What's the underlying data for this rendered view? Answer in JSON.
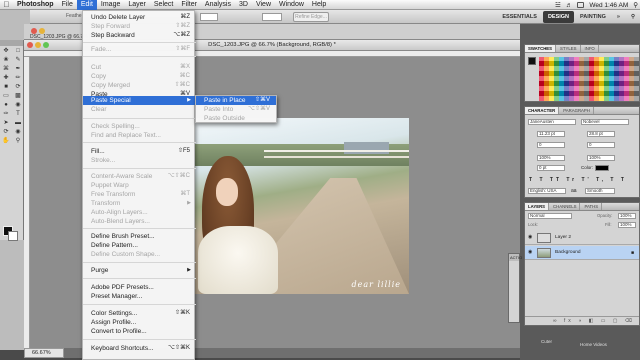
{
  "menubar": {
    "apple": "",
    "items": [
      "Photoshop",
      "File",
      "Edit",
      "Image",
      "Layer",
      "Select",
      "Filter",
      "Analysis",
      "3D",
      "View",
      "Window",
      "Help"
    ],
    "clock": "Wed 1:46 AM"
  },
  "options_bar": {
    "refine_label": "Refine Edge...",
    "feather_label": "Feathe",
    "workspaces": [
      "ESSENTIALS",
      "DESIGN",
      "PAINTING"
    ],
    "selected_workspace": "DESIGN",
    "cs_live": "CS Live"
  },
  "document": {
    "title": "DSC_1203.JPG @ 66.7% (Background, RGB/8) *",
    "behind_title": "DSC_1203.JPG @ 66.7% (Background, RGB/8) *",
    "zoom": "66.67%",
    "watermark": "dear lillie"
  },
  "edit_menu": {
    "items": [
      {
        "label": "Undo Delete Layer",
        "shortcut": "⌘Z",
        "disabled": false,
        "submenu": false
      },
      {
        "label": "Step Forward",
        "shortcut": "⇧⌘Z",
        "disabled": true,
        "submenu": false
      },
      {
        "label": "Step Backward",
        "shortcut": "⌥⌘Z",
        "disabled": false,
        "submenu": false
      },
      {
        "label": "Fade...",
        "shortcut": "⇧⌘F",
        "disabled": true,
        "submenu": false
      },
      {
        "label": "Cut",
        "shortcut": "⌘X",
        "disabled": true,
        "submenu": false
      },
      {
        "label": "Copy",
        "shortcut": "⌘C",
        "disabled": true,
        "submenu": false
      },
      {
        "label": "Copy Merged",
        "shortcut": "⇧⌘C",
        "disabled": true,
        "submenu": false
      },
      {
        "label": "Paste",
        "shortcut": "⌘V",
        "disabled": false,
        "submenu": false
      },
      {
        "label": "Paste Special",
        "shortcut": "",
        "disabled": false,
        "submenu": true,
        "selected": true
      },
      {
        "label": "Clear",
        "shortcut": "",
        "disabled": true,
        "submenu": false
      },
      {
        "label": "Check Spelling...",
        "shortcut": "",
        "disabled": true,
        "submenu": false
      },
      {
        "label": "Find and Replace Text...",
        "shortcut": "",
        "disabled": true,
        "submenu": false
      },
      {
        "label": "Fill...",
        "shortcut": "⇧F5",
        "disabled": false,
        "submenu": false
      },
      {
        "label": "Stroke...",
        "shortcut": "",
        "disabled": true,
        "submenu": false
      },
      {
        "label": "Content-Aware Scale",
        "shortcut": "⌥⇧⌘C",
        "disabled": true,
        "submenu": false
      },
      {
        "label": "Puppet Warp",
        "shortcut": "",
        "disabled": true,
        "submenu": false
      },
      {
        "label": "Free Transform",
        "shortcut": "⌘T",
        "disabled": true,
        "submenu": false
      },
      {
        "label": "Transform",
        "shortcut": "",
        "disabled": true,
        "submenu": true
      },
      {
        "label": "Auto-Align Layers...",
        "shortcut": "",
        "disabled": true,
        "submenu": false
      },
      {
        "label": "Auto-Blend Layers...",
        "shortcut": "",
        "disabled": true,
        "submenu": false
      },
      {
        "label": "Define Brush Preset...",
        "shortcut": "",
        "disabled": false,
        "submenu": false
      },
      {
        "label": "Define Pattern...",
        "shortcut": "",
        "disabled": false,
        "submenu": false
      },
      {
        "label": "Define Custom Shape...",
        "shortcut": "",
        "disabled": true,
        "submenu": false
      },
      {
        "label": "Purge",
        "shortcut": "",
        "disabled": false,
        "submenu": true
      },
      {
        "label": "Adobe PDF Presets...",
        "shortcut": "",
        "disabled": false,
        "submenu": false
      },
      {
        "label": "Preset Manager...",
        "shortcut": "",
        "disabled": false,
        "submenu": false
      },
      {
        "label": "Color Settings...",
        "shortcut": "⇧⌘K",
        "disabled": false,
        "submenu": false
      },
      {
        "label": "Assign Profile...",
        "shortcut": "",
        "disabled": false,
        "submenu": false
      },
      {
        "label": "Convert to Profile...",
        "shortcut": "",
        "disabled": false,
        "submenu": false
      },
      {
        "label": "Keyboard Shortcuts...",
        "shortcut": "⌥⇧⌘K",
        "disabled": false,
        "submenu": false
      }
    ]
  },
  "paste_special_menu": {
    "items": [
      {
        "label": "Paste in Place",
        "shortcut": "⇧⌘V",
        "disabled": false,
        "selected": true
      },
      {
        "label": "Paste Into",
        "shortcut": "⌥⇧⌘V",
        "disabled": true,
        "selected": false
      },
      {
        "label": "Paste Outside",
        "shortcut": "",
        "disabled": true,
        "selected": false
      }
    ]
  },
  "panels": {
    "swatches_tabs": [
      "SWATCHES",
      "STYLES",
      "INFO"
    ],
    "character_tabs": [
      "CHARACTER",
      "PARAGRAPH"
    ],
    "font_name": "JaneAusten",
    "font_style": "Nobevel",
    "font_size": "11.23 pt",
    "leading": "28.8 pt",
    "kerning": "0",
    "tracking": "0",
    "vscale": "100%",
    "hscale": "100%",
    "baseline": "0 pt",
    "color_label": "Color:",
    "language": "English: USA",
    "aa": "aa",
    "antialias": "Smooth",
    "layers_tabs": [
      "LAYERS",
      "CHANNELS",
      "PATHS"
    ],
    "blend_mode": "Normal",
    "opacity_label": "Opacity:",
    "opacity": "100%",
    "lock_label": "Lock:",
    "fill_label": "Fill:",
    "fill": "100%",
    "layers": [
      "Layer 2",
      "Background"
    ],
    "actions_tab": "ACTIO"
  },
  "desktop": {
    "home_videos": "Home Videos",
    "cuter": "Cuter"
  }
}
